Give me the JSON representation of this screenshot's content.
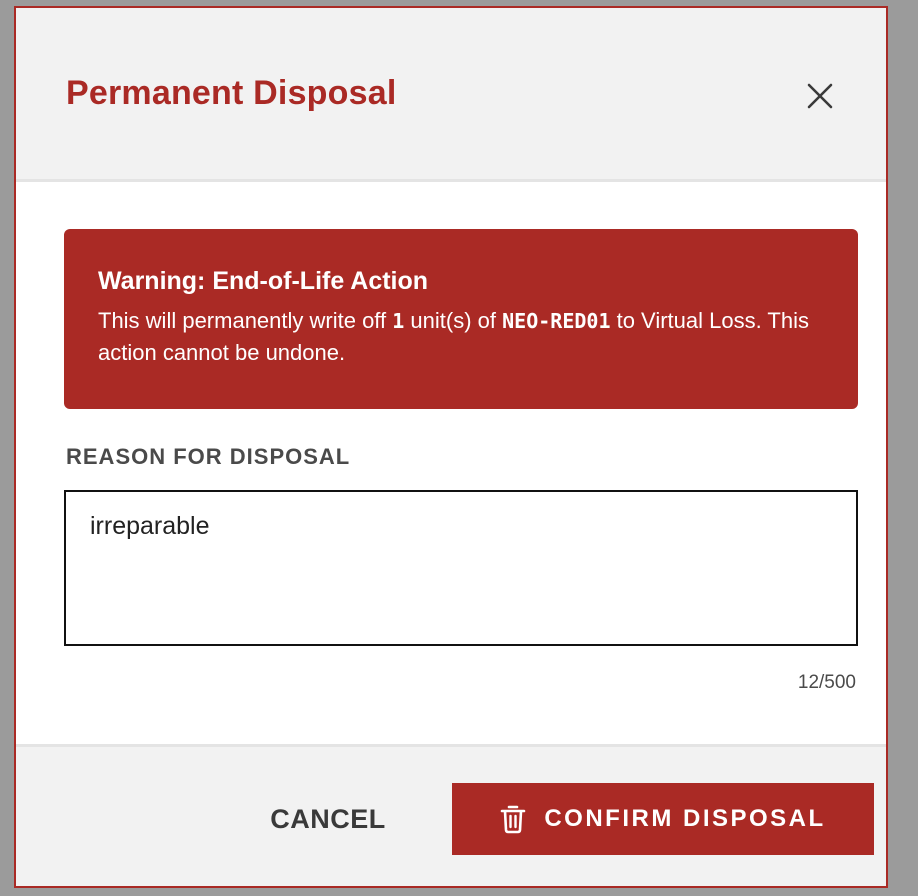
{
  "colors": {
    "accent": "#aa2a25",
    "overlay": "#9b9b9b",
    "header_bg": "#f2f2f2"
  },
  "dialog": {
    "title": "Permanent Disposal",
    "close_icon": "close-icon"
  },
  "warning": {
    "title": "Warning: End-of-Life Action",
    "text_1": "This will permanently write off ",
    "quantity": "1",
    "text_2": " unit(s) of ",
    "sku": "NEO-RED01",
    "text_3": " to Virtual Loss. This action cannot be undone."
  },
  "reason": {
    "label": "REASON FOR DISPOSAL",
    "value": "irreparable",
    "char_count": "12/500"
  },
  "footer": {
    "cancel_label": "CANCEL",
    "confirm_label": "CONFIRM DISPOSAL",
    "confirm_icon": "trash-icon"
  }
}
